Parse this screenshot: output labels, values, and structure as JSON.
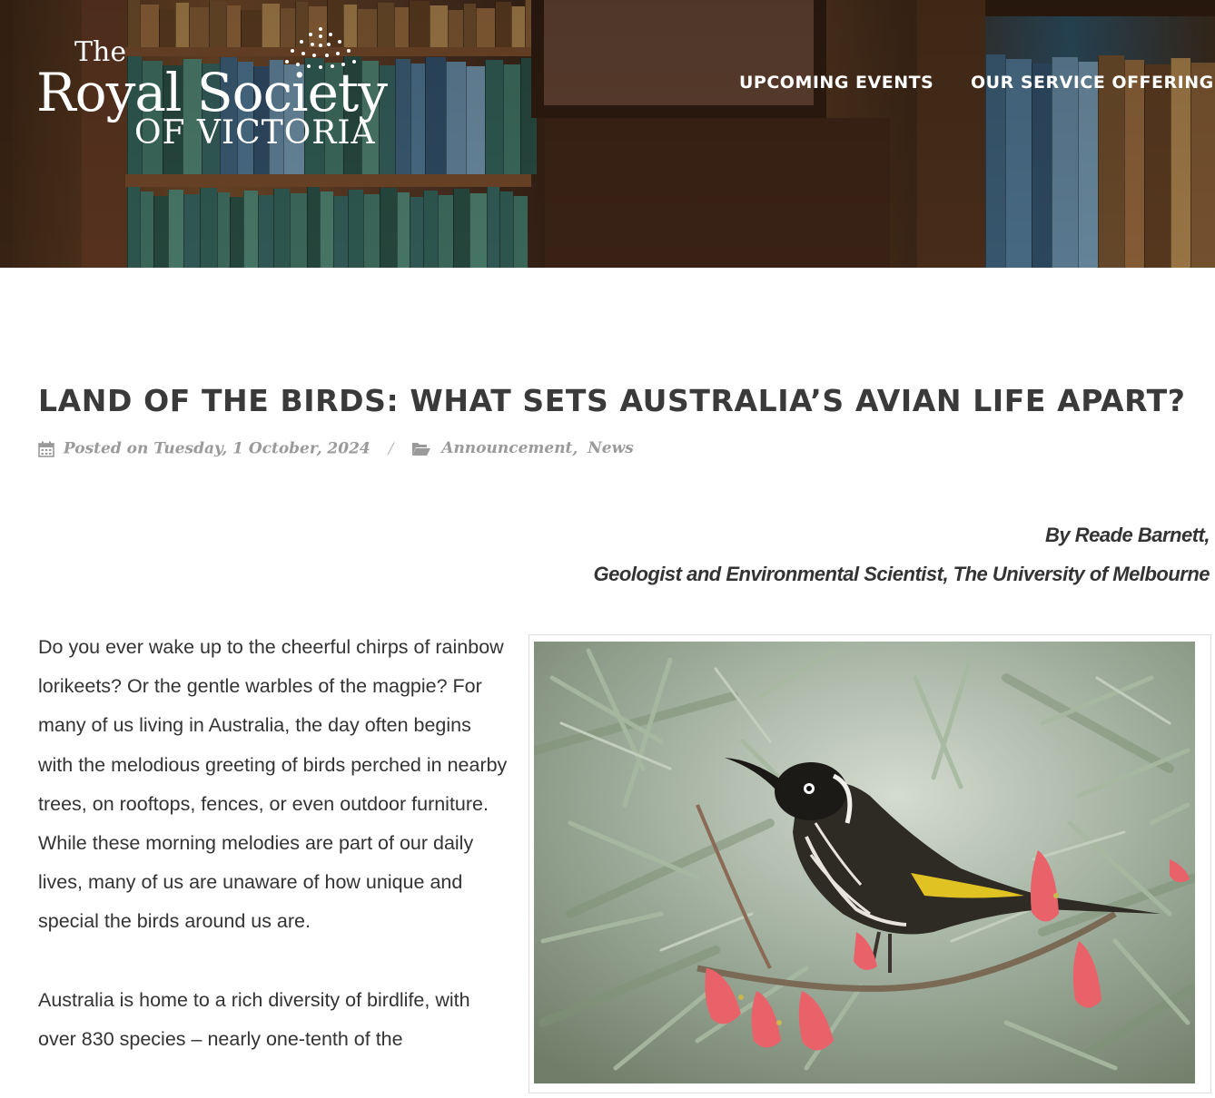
{
  "site": {
    "logo": {
      "line1": "The",
      "line2": "Royal Society",
      "line3": "OF VICTORIA"
    },
    "nav": [
      {
        "label": "UPCOMING EVENTS"
      },
      {
        "label": "OUR SERVICE OFFERINGS"
      }
    ]
  },
  "article": {
    "title": "LAND OF THE BIRDS: WHAT SETS AUSTRALIA’S AVIAN LIFE APART?",
    "meta": {
      "posted_label": "Posted on Tuesday, 1 October, 2024",
      "separator": "/",
      "categories": [
        "Announcement",
        "News"
      ],
      "category_joiner": ","
    },
    "byline": {
      "author": "By Reade Barnett,",
      "affiliation": "Geologist and Environmental Scientist, The University of Melbourne"
    },
    "paragraphs": [
      "Do you ever wake up to the cheerful chirps of rainbow lorikeets? Or the gentle warbles of the magpie? For many of us living in Australia, the day often begins with the melodious greeting of birds perched in nearby trees, on rooftops, fences, or even outdoor furniture. While these morning melodies are part of our daily lives, many of us are unaware of how unique and special the birds around us are.",
      "Australia is home to a rich diversity of birdlife, with over 830 species – nearly one-tenth of the"
    ]
  },
  "icons": {
    "calendar": "calendar-icon",
    "folder": "folder-open-icon"
  },
  "colors": {
    "title": "#3a3a3a",
    "meta": "#9a9a9a",
    "body": "#333333",
    "nav": "#ffffff"
  }
}
